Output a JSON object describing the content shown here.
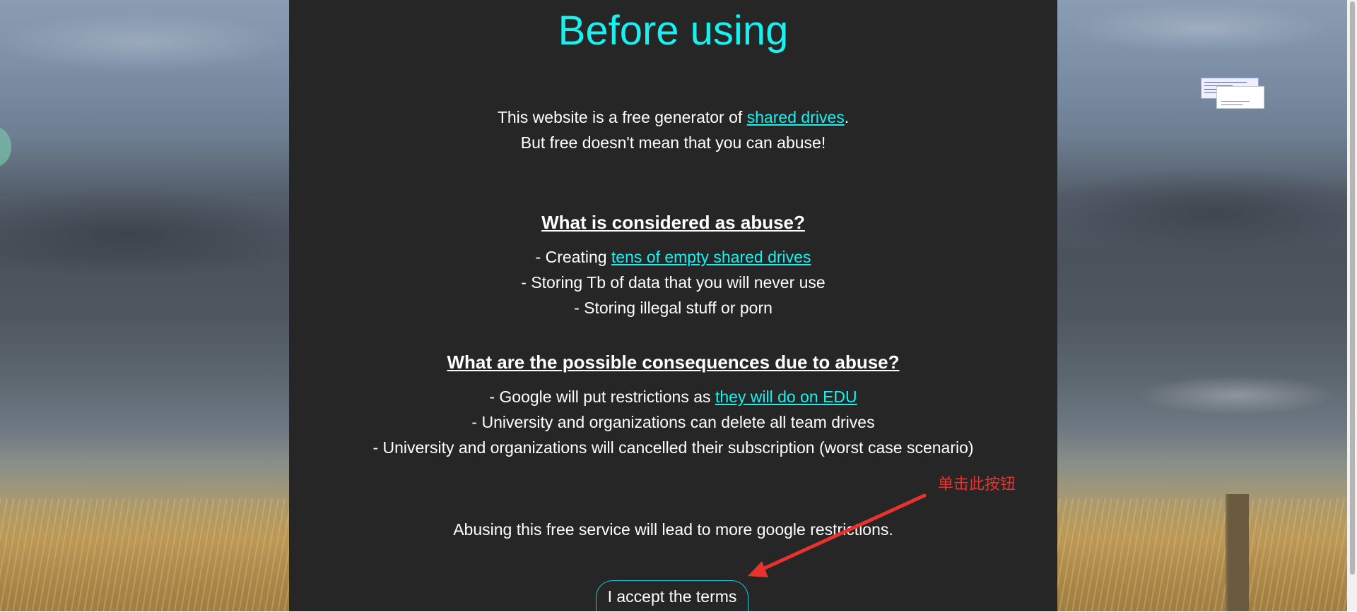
{
  "page": {
    "title": "Before using",
    "intro_before_link": "This website is a free generator of ",
    "intro_link": "shared drives",
    "intro_after_link": ".",
    "intro_line2": "But free doesn't mean that you can abuse!"
  },
  "abuse_section": {
    "heading": "What is considered as abuse?",
    "items": [
      {
        "prefix": "- Creating ",
        "link": "tens of empty shared drives"
      },
      {
        "text": "- Storing Tb of data that you will never use"
      },
      {
        "text": "- Storing illegal stuff or porn"
      }
    ]
  },
  "consequences_section": {
    "heading": "What are the possible consequences due to abuse?",
    "items": [
      {
        "prefix": "- Google will put restrictions as ",
        "link": "they will do on EDU"
      },
      {
        "text": "- University and organizations can delete all team drives"
      },
      {
        "text": "- University and organizations will cancelled their subscription (worst case scenario)"
      }
    ]
  },
  "warning": "Abusing this free service will lead to more google restrictions.",
  "accept_button": "I accept the terms",
  "annotation": {
    "text": "单击此按钮",
    "color": "#e8322e"
  },
  "colors": {
    "accent": "#19f0f0",
    "panel_bg": "#262626"
  }
}
